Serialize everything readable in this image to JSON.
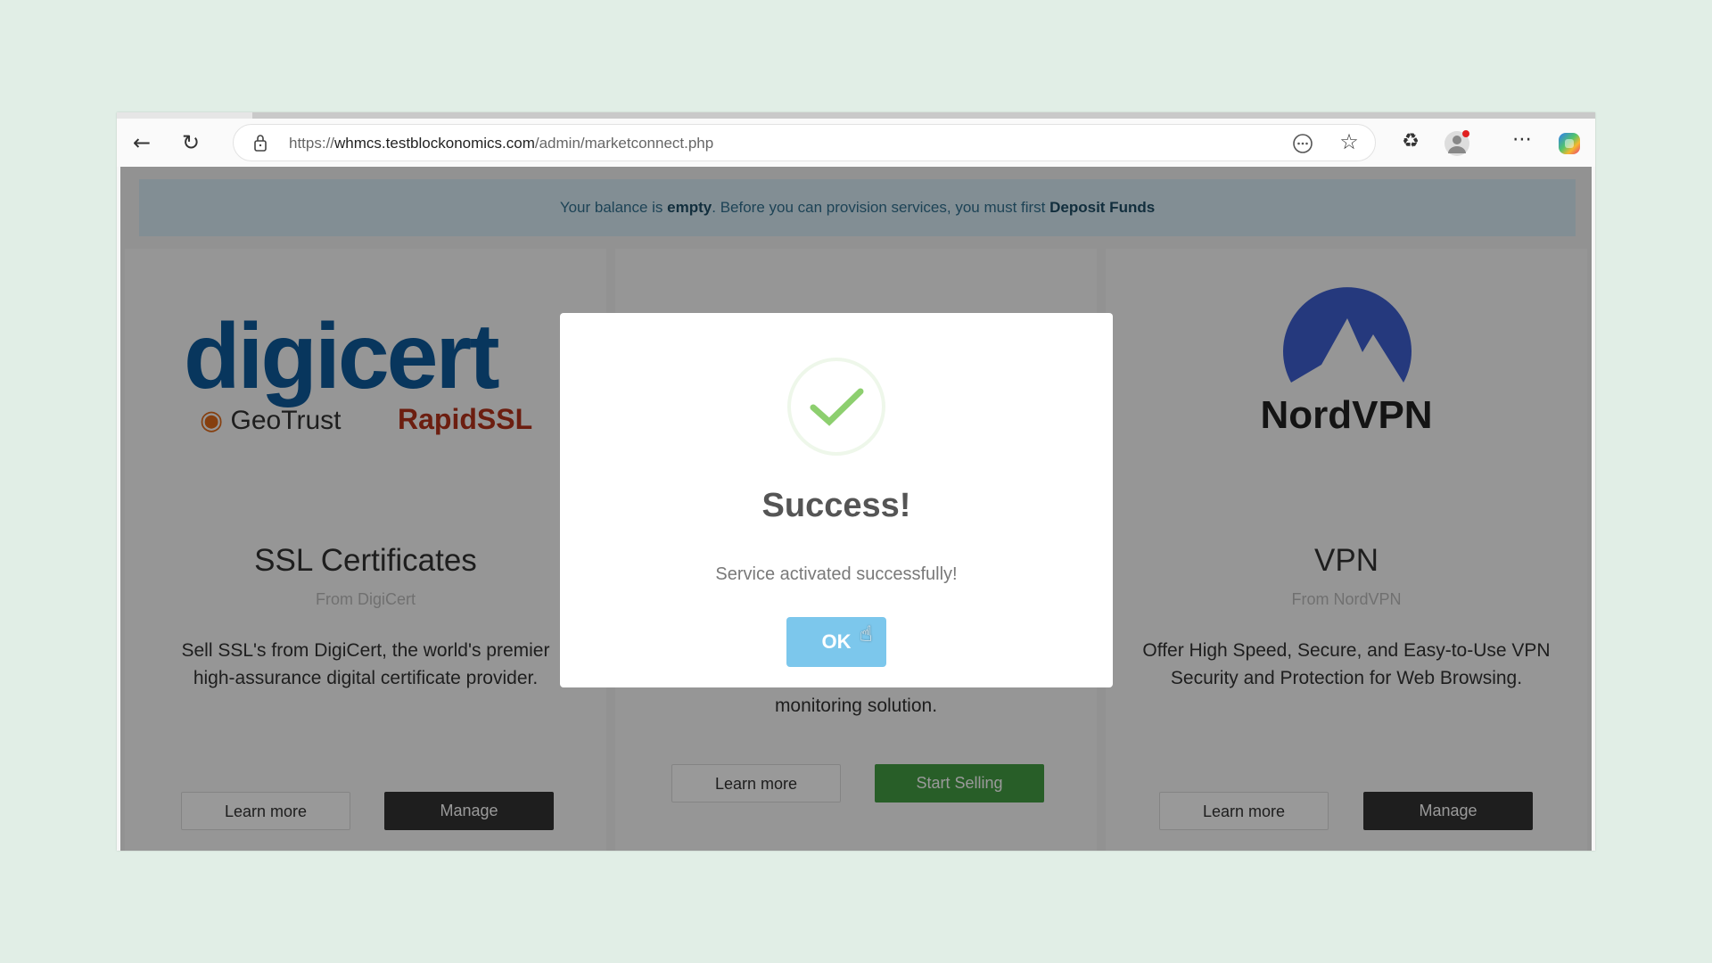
{
  "browser": {
    "url_prefix": "https://",
    "url_host": "whmcs.testblockonomics.com",
    "url_path": "/admin/marketconnect.php",
    "icons": [
      "back-icon",
      "refresh-icon",
      "lock-icon",
      "reader-icon",
      "favorite-star-icon",
      "extensions-icon",
      "profile-avatar-icon",
      "more-icon",
      "copilot-icon"
    ]
  },
  "banner": {
    "text1": "Your balance is ",
    "bold1": "empty",
    "text2": ". Before you can provision services, you must first ",
    "bold2": "Deposit Funds"
  },
  "cards": [
    {
      "logo": "digicert",
      "logo_sub1": "GeoTrust",
      "logo_sub2": "RapidSSL",
      "title": "SSL Certificates",
      "subtitle": "From DigiCert",
      "description": "Sell SSL's from DigiCert, the world's premier high-assurance digital certificate provider.",
      "learn_more": "Learn more",
      "action": "Manage"
    },
    {
      "description": "monitoring solution.",
      "learn_more": "Learn more",
      "action": "Start Selling"
    },
    {
      "logo": "NordVPN",
      "title": "VPN",
      "subtitle": "From NordVPN",
      "description": "Offer High Speed, Secure, and Easy-to-Use VPN Security and Protection for Web Browsing.",
      "learn_more": "Learn more",
      "action": "Manage"
    }
  ],
  "modal": {
    "title": "Success!",
    "message": "Service activated successfully!",
    "ok": "OK",
    "icon": "success-check-icon"
  },
  "colors": {
    "ok_button": "#7cc7ec",
    "check": "#8dcf6f",
    "start_selling": "#449d44",
    "digicert_blue": "#0e5a9c",
    "nordvpn_blue": "#3e5fd0"
  }
}
